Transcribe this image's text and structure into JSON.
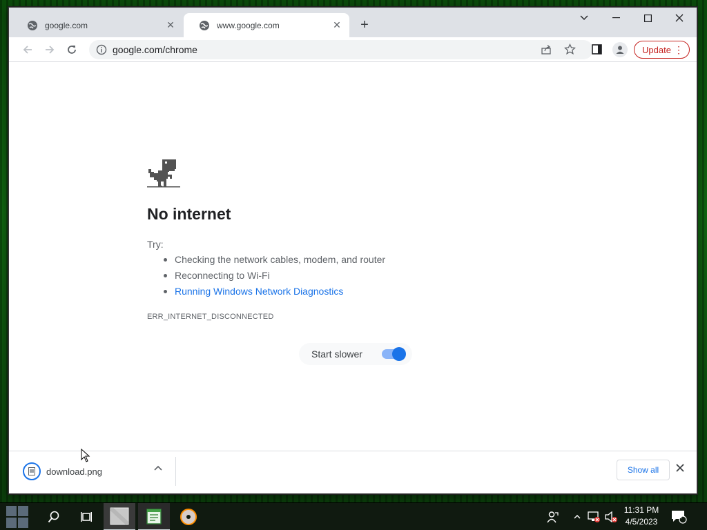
{
  "browser": {
    "tabs": [
      {
        "label": "google.com",
        "active": false
      },
      {
        "label": "www.google.com",
        "active": true
      }
    ],
    "new_tab_symbol": "+",
    "address": "google.com/chrome",
    "update_label": "Update"
  },
  "page": {
    "title": "No internet",
    "try_label": "Try:",
    "suggestions": [
      "Checking the network cables, modem, and router",
      "Reconnecting to Wi-Fi",
      "Running Windows Network Diagnostics"
    ],
    "error_code": "ERR_INTERNET_DISCONNECTED",
    "toggle_label": "Start slower",
    "toggle_on": true
  },
  "downloads": {
    "file_name": "download.png",
    "show_all_label": "Show all"
  },
  "taskbar": {
    "time": "11:31 PM",
    "date": "4/5/2023",
    "notification_count": "1"
  },
  "colors": {
    "link": "#1a73e8",
    "update": "#c5221f",
    "taskbar": "#101a10"
  }
}
